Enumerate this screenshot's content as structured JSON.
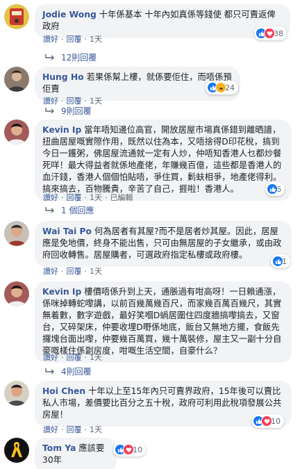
{
  "actions": {
    "like": "讚好",
    "reply": "回覆",
    "edited": "已編輯",
    "sep": "·"
  },
  "colors": {
    "link": "#385898",
    "bubble": "#f2f3f5",
    "like": "#1877f2",
    "love": "#f33e58",
    "haha": "#f7b125"
  },
  "comments": [
    {
      "author": "Jodie Wong",
      "text": "十年係基本 十年內如真係等錢使 都只可賣返俾政府",
      "time": "1天",
      "reactions": [
        "like",
        "love"
      ],
      "reaction_count": "38",
      "replies": "12則回覆"
    },
    {
      "author": "Hung Ho",
      "text": "若果係幫上樓，就係要佢住，而唔係預佢賣",
      "time": "1天",
      "reactions": [
        "like",
        "haha"
      ],
      "reaction_count": "24",
      "replies": "9則回覆"
    },
    {
      "author": "Kevin Ip",
      "text": "當年唔知邊位高官，開放居屋市場真係錯到離晒譜，扭曲居屋嘅實際作用，既然以住為本，又唔捨得D印花稅，搞到今日一鑊粥，佛居屋流通就一定有人炒，仲唔知香港人乜都炒餐死咩！最大得益者就係地產佬，年賺幾百億，這些都是香港人的血汗錢，香港人個個怕貼唔，爭住買，鬁蚨相爭，地產佬得利。搞來搞去，百物騰貴，辛苦了自己，捱啦！香港人。",
      "time": "1天",
      "edited": true,
      "reactions": [
        "like"
      ],
      "reaction_count": "6",
      "replies": "1 個回應"
    },
    {
      "author": "Wai Tai Po",
      "text": "何為居者有其屋?而不是居者炒其屋。因此，居屋應是免地價，終身不能出售，只可由無居屋的子女繼承，或由政府回收轉售。居屋購者，可選政府指定私樓或政府樓。",
      "time": "1天",
      "reactions": [
        "like"
      ],
      "reaction_count": "1",
      "replies": ""
    },
    {
      "author": "Kevin Ip",
      "text": "樓價唔係升到上天，通脹過有咁高呀！一日賴通漲，係咪掉轉蛇嚟講，以前百幾萬幾百尺，而家幾百萬百幾尺，其實無着數，數字遊戲，最好笑嗰D蝸居圍住四度牆搞嚟搞去，又窗台，又碎架床，仲要收埋D嘢係地底，飯台又無地方擺，食飯先攞塊台面出嚟，仲要幾百萬買，幾十萬裝修，屋主又一副十分自豪嘅樣住係劏房度，咁嘅生活空間，自豪什么？",
      "time": "1天",
      "reactions": [],
      "reaction_count": "",
      "replies": "4則回覆"
    },
    {
      "author": "Hoi Chen",
      "text": "十年以上至15年內只可賣界政府，15年後可以賣比私人市場，差價要比百分之五十稅，政府可利用此稅項發展公共房屋！",
      "time": "1天",
      "reactions": [
        "like",
        "love"
      ],
      "reaction_count": "10",
      "replies": ""
    },
    {
      "author": "Tom Ya",
      "text": "應該要30年",
      "time": "",
      "reactions": [
        "like",
        "love"
      ],
      "reaction_count": "10",
      "replies": ""
    }
  ]
}
